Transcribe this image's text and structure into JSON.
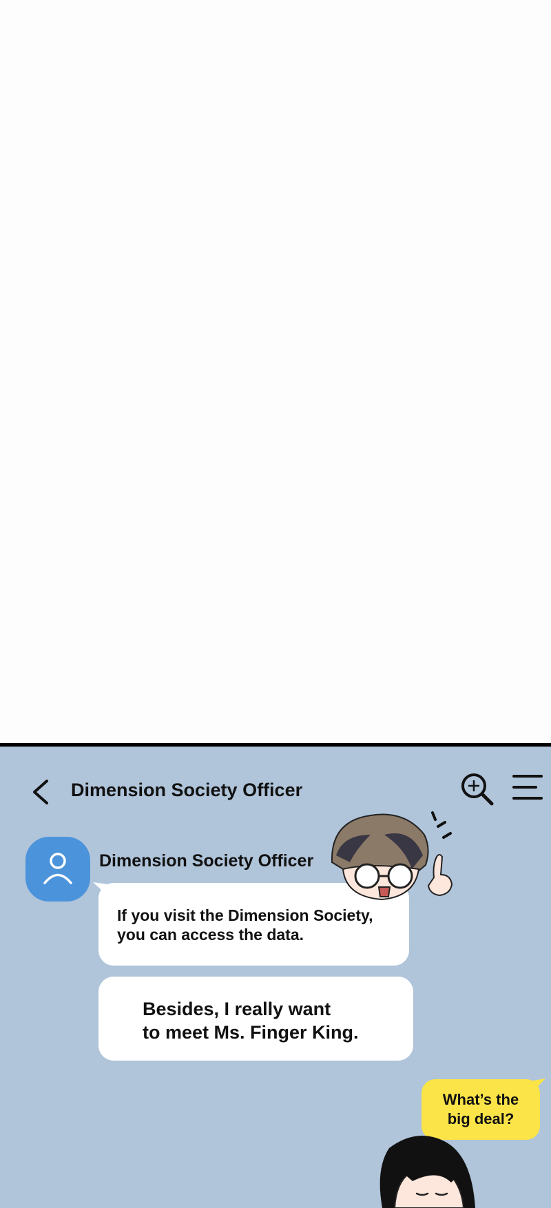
{
  "chat": {
    "title": "Dimension Society Officer",
    "sender_name": "Dimension Society Officer",
    "messages": [
      "If you visit the Dimension Society,\nyou can access the data.",
      "Besides, I really want\nto meet Ms. Finger King."
    ],
    "reply": "What’s the\nbig deal?"
  },
  "icons": {
    "back": "chevron-left-icon",
    "search": "zoom-in-search-icon",
    "menu": "hamburger-menu-icon",
    "avatar": "person-icon"
  },
  "colors": {
    "chat_background": "#b0c4da",
    "avatar": "#4b94db",
    "incoming_bubble": "#ffffff",
    "outgoing_bubble": "#fbe448"
  }
}
